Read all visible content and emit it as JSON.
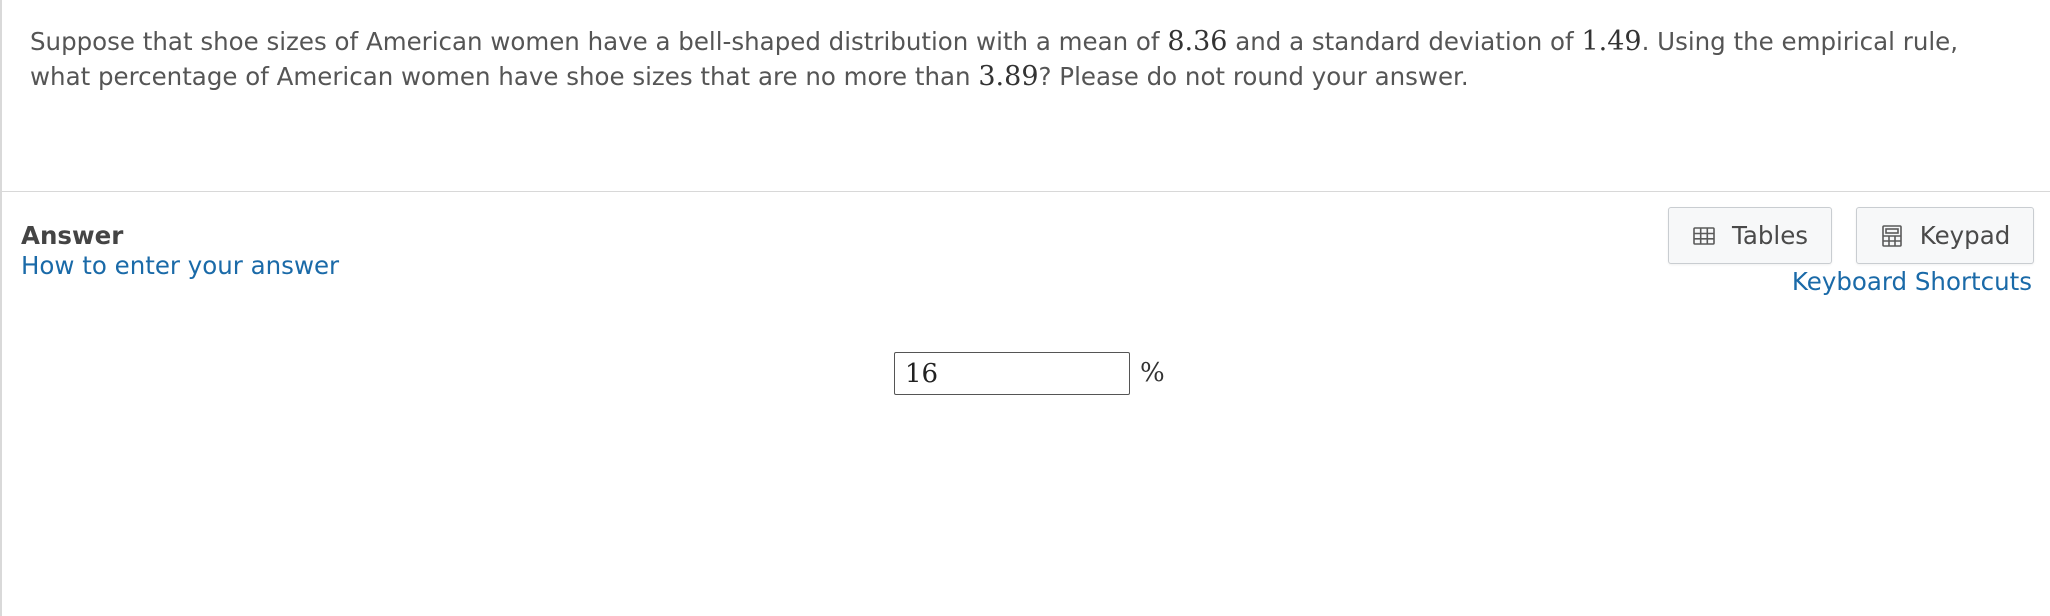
{
  "question": {
    "part1": "Suppose that shoe sizes of American women have a bell-shaped distribution with a mean of ",
    "mean": "8.36",
    "part2": " and a standard deviation of ",
    "sd": "1.49",
    "part3": ".  Using the empirical rule, what percentage of American women have shoe sizes that are no more than ",
    "threshold": "3.89",
    "part4": "?  Please do not round your answer."
  },
  "answer": {
    "heading": "Answer",
    "how_to_link": "How to enter your answer",
    "input_value": "16",
    "unit": "%"
  },
  "tools": {
    "tables_label": "Tables",
    "keypad_label": "Keypad",
    "shortcuts_link": "Keyboard Shortcuts"
  },
  "colors": {
    "link": "#1a6aa8",
    "text": "#555555",
    "button_bg": "#f7f8f9",
    "button_border": "#c9cdd1"
  },
  "icons": {
    "tables": "table-grid-icon",
    "keypad": "calculator-icon"
  }
}
